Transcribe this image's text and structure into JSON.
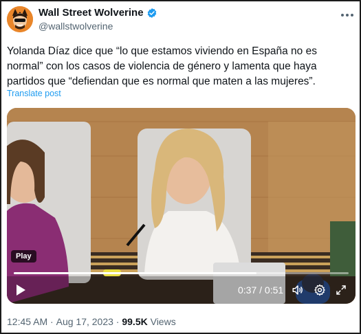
{
  "author": {
    "display_name": "Wall Street Wolverine",
    "handle": "@wallstwolverine",
    "avatar_icon": "wolverine-avatar",
    "verified_icon": "verified-badge-icon"
  },
  "menu_icon": "more-icon",
  "tweet": {
    "text": "Yolanda Díaz dice que “lo que estamos viviendo en España no es normal” con los casos de violencia de género y lamenta que haya partidos que “defiendan que es normal que maten a las mujeres”.",
    "translate_label": "Translate post"
  },
  "video": {
    "play_badge": "Play",
    "time_display": "0:37 / 0:51",
    "progress_fraction": 0.725,
    "controls": {
      "play": "play-icon",
      "volume": "volume-icon",
      "settings": "gear-icon",
      "fullscreen": "fullscreen-icon"
    }
  },
  "meta": {
    "time": "12:45 AM",
    "separator": " · ",
    "date": "Aug 17, 2023",
    "views_count": "99.5K",
    "views_label": " Views"
  },
  "colors": {
    "link": "#1d9bf0",
    "muted": "#536471",
    "verified": "#1d9bf0"
  }
}
